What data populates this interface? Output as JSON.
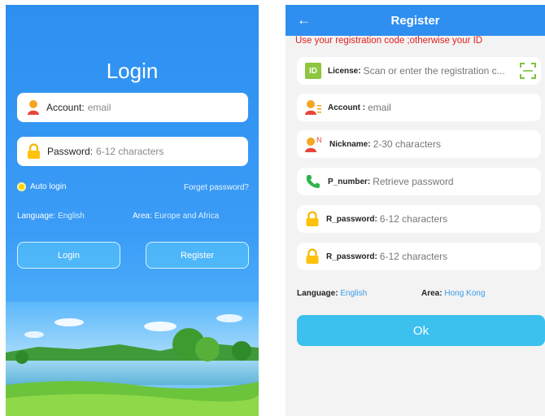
{
  "login": {
    "title": "Login",
    "account_label": "Account:",
    "account_placeholder": "email",
    "password_label": "Password:",
    "password_placeholder": "6-12 characters",
    "auto_login": "Auto login",
    "forgot_password": "Forget password?",
    "language_label": "Language:",
    "language_value": "English",
    "area_label": "Area:",
    "area_value": "Europe and Africa",
    "login_button": "Login",
    "register_button": "Register"
  },
  "register": {
    "title": "Register",
    "notice": "Use your registration code ;otherwise your ID",
    "fields": [
      {
        "icon": "id-badge-icon",
        "badge": "ID",
        "label": "License:",
        "placeholder": "Scan or enter the registration c..."
      },
      {
        "icon": "user-icon",
        "label": "Account :",
        "placeholder": "email"
      },
      {
        "icon": "user-nickname-icon",
        "badge": "N",
        "label": "Nickname:",
        "placeholder": "2-30 characters"
      },
      {
        "icon": "phone-icon",
        "label": "P_number:",
        "placeholder": "Retrieve password"
      },
      {
        "icon": "lock-icon",
        "label": "R_password:",
        "placeholder": "6-12 characters"
      },
      {
        "icon": "lock-icon",
        "label": "R_password:",
        "placeholder": "6-12 characters"
      }
    ],
    "language_label": "Language:",
    "language_value": "English",
    "area_label": "Area:",
    "area_value": "Hong Kong",
    "ok_button": "Ok"
  },
  "colors": {
    "header_blue": "#2e8ff0",
    "login_bg": "#3a9cf6",
    "button_cyan": "#3cc0ee",
    "notice_red": "#e02020",
    "link_blue": "#3a9be8",
    "radio_yellow": "#ffd200"
  }
}
